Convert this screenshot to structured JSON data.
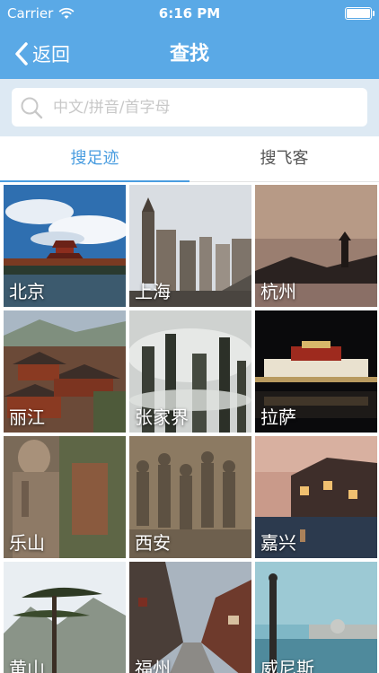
{
  "status_bar": {
    "carrier": "Carrier",
    "time": "6:16 PM"
  },
  "nav": {
    "back_label": "返回",
    "title": "查找"
  },
  "search": {
    "placeholder": "中文/拼音/首字母"
  },
  "tabs": [
    {
      "label": "搜足迹",
      "active": true
    },
    {
      "label": "搜飞客",
      "active": false
    }
  ],
  "colors": {
    "accent": "#5aa9e6",
    "tab_active": "#4a9de0"
  },
  "cities": [
    {
      "name": "北京"
    },
    {
      "name": "上海"
    },
    {
      "name": "杭州"
    },
    {
      "name": "丽江"
    },
    {
      "name": "张家界"
    },
    {
      "name": "拉萨"
    },
    {
      "name": "乐山"
    },
    {
      "name": "西安"
    },
    {
      "name": "嘉兴"
    },
    {
      "name": "黄山"
    },
    {
      "name": "福州"
    },
    {
      "name": "威尼斯"
    }
  ]
}
